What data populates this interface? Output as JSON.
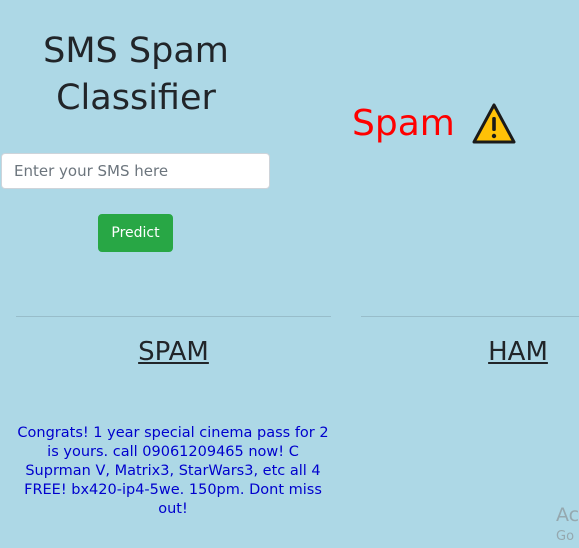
{
  "app": {
    "title_line1": "SMS Spam",
    "title_line2": "Classifier"
  },
  "form": {
    "input_placeholder": "Enter your SMS here",
    "input_value": "",
    "predict_label": "Predict"
  },
  "result": {
    "label": "Spam",
    "color": "#ff0000",
    "icon": "warning-icon"
  },
  "columns": {
    "spam_heading": "SPAM",
    "ham_heading": "HAM",
    "spam_messages": [
      "Congrats! 1 year special cinema pass for 2 is yours. call 09061209465 now! C Suprman V, Matrix3, StarWars3, etc all 4 FREE! bx420-ip4-5we. 150pm. Dont miss out!"
    ],
    "ham_messages": []
  },
  "watermark": {
    "line1": "Ac",
    "line2": "Go"
  },
  "colors": {
    "background": "#add8e6",
    "button": "#28a745",
    "message_text": "#0000cd"
  }
}
